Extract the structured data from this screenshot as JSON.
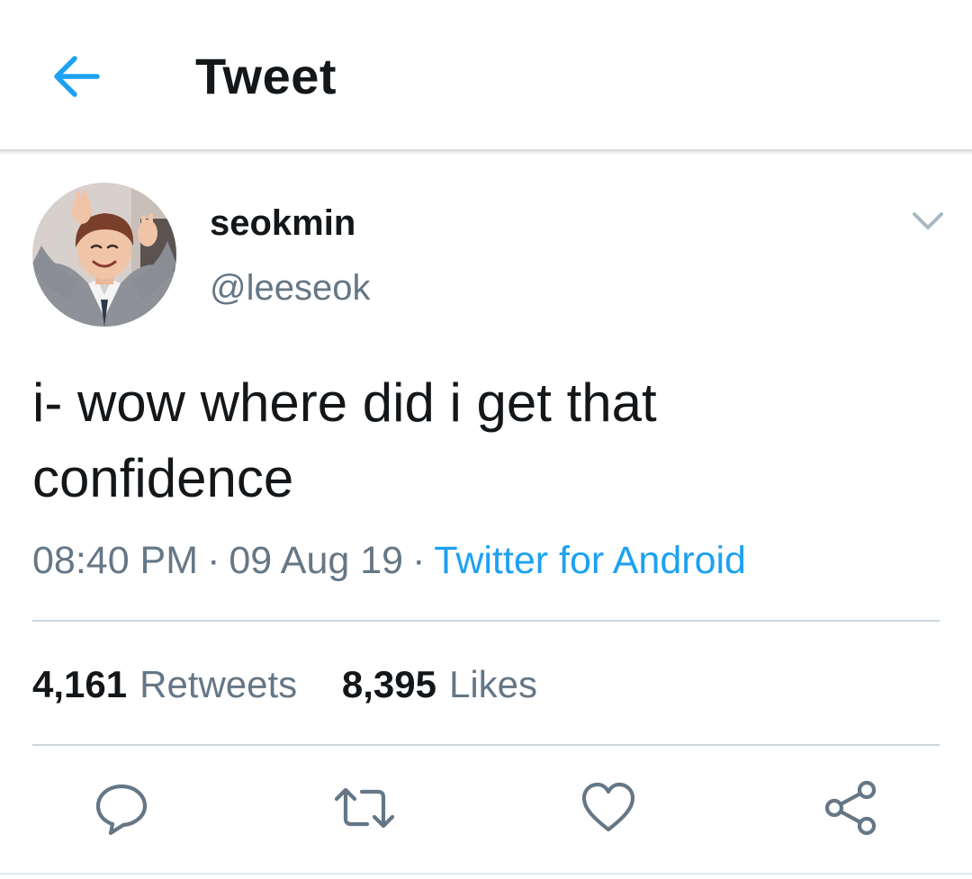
{
  "header": {
    "title": "Tweet"
  },
  "tweet": {
    "display_name": "seokmin",
    "handle": "@leeseok",
    "text_line1": "i- wow where did i get that",
    "text_line2": "confidence",
    "time": "08:40 PM",
    "date": "09 Aug 19",
    "separator": "·",
    "source": "Twitter for Android"
  },
  "stats": {
    "retweets_count": "4,161",
    "retweets_label": "Retweets",
    "likes_count": "8,395",
    "likes_label": "Likes"
  },
  "colors": {
    "accent": "#1da1f2",
    "text_primary": "#14171a",
    "text_secondary": "#657786",
    "divider": "#ccd6dd"
  },
  "icons": {
    "back": "arrow-left-icon",
    "caret": "chevron-down-icon",
    "reply": "reply-icon",
    "retweet": "retweet-icon",
    "like": "heart-icon",
    "share": "share-icon"
  }
}
